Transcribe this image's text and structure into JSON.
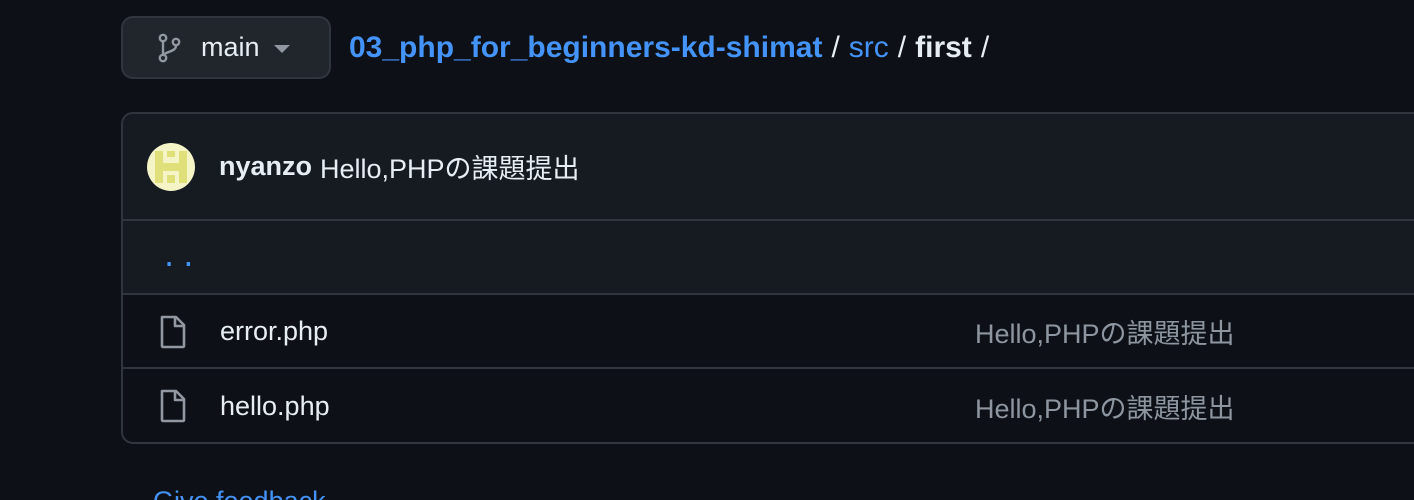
{
  "branch": {
    "name": "main",
    "icon": "git-branch-icon"
  },
  "breadcrumb": {
    "repo": "03_php_for_beginners-kd-shimat",
    "separator": "/",
    "items": [
      "src"
    ],
    "current": "first"
  },
  "commit": {
    "author": "nyanzo",
    "message": "Hello,PHPの課題提出",
    "avatar_colors": [
      "#e5e58a",
      "#f4f4c7"
    ]
  },
  "files": {
    "parent_label": "..",
    "rows": [
      {
        "name": "error.php",
        "icon": "file-icon",
        "commit_message": "Hello,PHPの課題提出"
      },
      {
        "name": "hello.php",
        "icon": "file-icon",
        "commit_message": "Hello,PHPの課題提出"
      }
    ]
  },
  "footer": {
    "link_label": "Give feedback"
  },
  "colors": {
    "background": "#0d1117",
    "link": "#4493f8",
    "border": "#30363d",
    "muted": "#8d96a0"
  }
}
